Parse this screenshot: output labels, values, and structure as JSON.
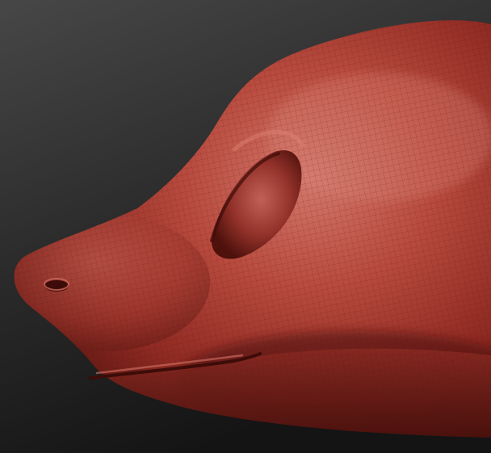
{
  "scene": {
    "background_color": "#2b2b2b",
    "material_color": "#a8392f",
    "highlight_color": "#e08478",
    "shadow_color": "#3d0c09"
  }
}
